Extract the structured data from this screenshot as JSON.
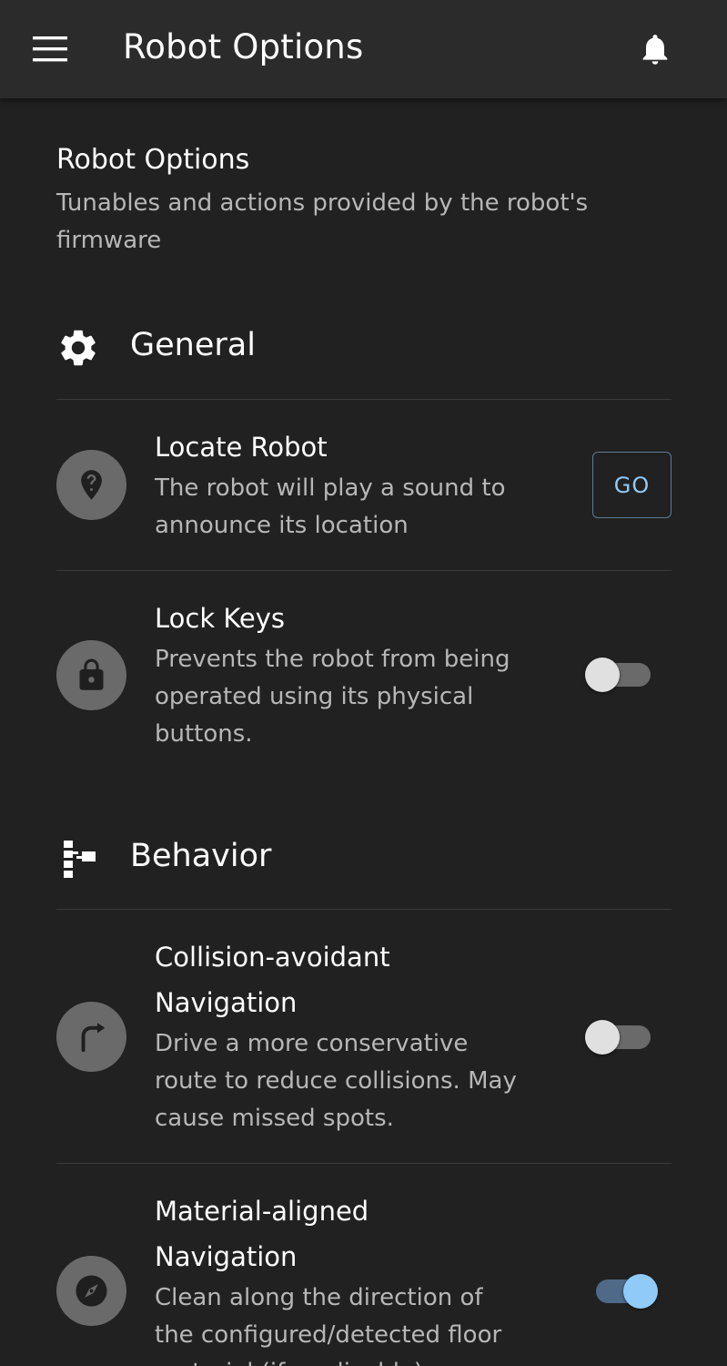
{
  "appbar": {
    "title": "Robot Options"
  },
  "page": {
    "title": "Robot Options",
    "subtitle": "Tunables and actions provided by the robot's firmware"
  },
  "sections": {
    "general": {
      "label": "General",
      "items": {
        "locate": {
          "title": "Locate Robot",
          "description": "The robot will play a sound to announce its location",
          "action_label": "GO"
        },
        "lock_keys": {
          "title": "Lock Keys",
          "description": "Prevents the robot from being operated using its physical buttons.",
          "enabled": false
        }
      }
    },
    "behavior": {
      "label": "Behavior",
      "items": {
        "collision": {
          "title": "Collision-avoidant Navigation",
          "description": "Drive a more conservative route to reduce collisions. May cause missed spots.",
          "enabled": false
        },
        "material": {
          "title": "Material-aligned Navigation",
          "description": "Clean along the direction of the configured/detected floor material (if applicable).",
          "enabled": true
        }
      }
    }
  },
  "colors": {
    "background": "#212121",
    "appbar": "#2b2b2b",
    "accent": "#90caf9",
    "secondary_text": "#b7b7b7",
    "avatar": "#6a6a6a"
  },
  "icons": {
    "menu": "menu-icon",
    "notifications": "bell-icon",
    "general": "gear-icon",
    "behavior": "tree-structure-icon",
    "locate": "location-question-icon",
    "lock_keys": "lock-icon",
    "collision": "turn-right-arrow-icon",
    "material": "compass-icon"
  }
}
